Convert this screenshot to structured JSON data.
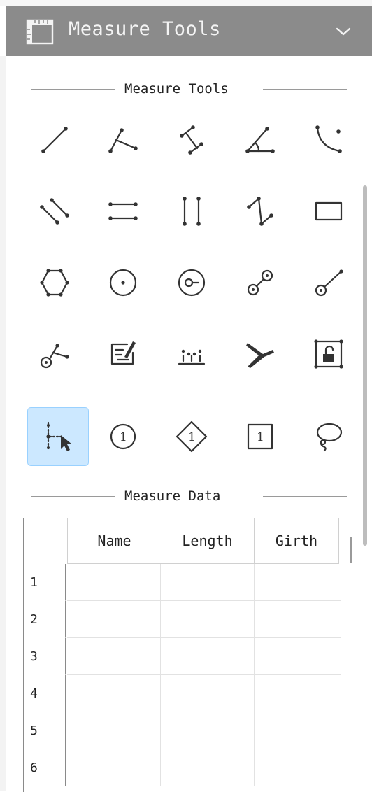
{
  "header": {
    "title": "Measure Tools",
    "collapse_icon": "chevron-down-icon"
  },
  "sections": {
    "tools_title": "Measure Tools",
    "data_title": "Measure Data"
  },
  "tools": [
    {
      "name": "line-icon"
    },
    {
      "name": "perpendicular-icon"
    },
    {
      "name": "parallel-distance-icon"
    },
    {
      "name": "angle-icon"
    },
    {
      "name": "curve-icon"
    },
    {
      "name": "parallel-lines-icon"
    },
    {
      "name": "horizontal-lines-icon"
    },
    {
      "name": "vertical-lines-icon"
    },
    {
      "name": "zigzag-icon"
    },
    {
      "name": "rectangle-icon"
    },
    {
      "name": "polygon-icon"
    },
    {
      "name": "circle-center-icon"
    },
    {
      "name": "circle-radius-icon"
    },
    {
      "name": "two-circles-icon"
    },
    {
      "name": "circle-line-icon"
    },
    {
      "name": "circle-perpendicular-icon"
    },
    {
      "name": "annotation-icon"
    },
    {
      "name": "point-count-icon"
    },
    {
      "name": "scissors-icon"
    },
    {
      "name": "lock-icon"
    },
    {
      "name": "point-select-icon",
      "selected": true
    },
    {
      "name": "circle-number-icon",
      "label": "1"
    },
    {
      "name": "diamond-number-icon",
      "label": "1"
    },
    {
      "name": "square-number-icon",
      "label": "1"
    },
    {
      "name": "lasso-icon"
    }
  ],
  "table": {
    "columns": [
      "Name",
      "Length",
      "Girth"
    ],
    "rows": [
      "1",
      "2",
      "3",
      "4",
      "5",
      "6"
    ]
  }
}
